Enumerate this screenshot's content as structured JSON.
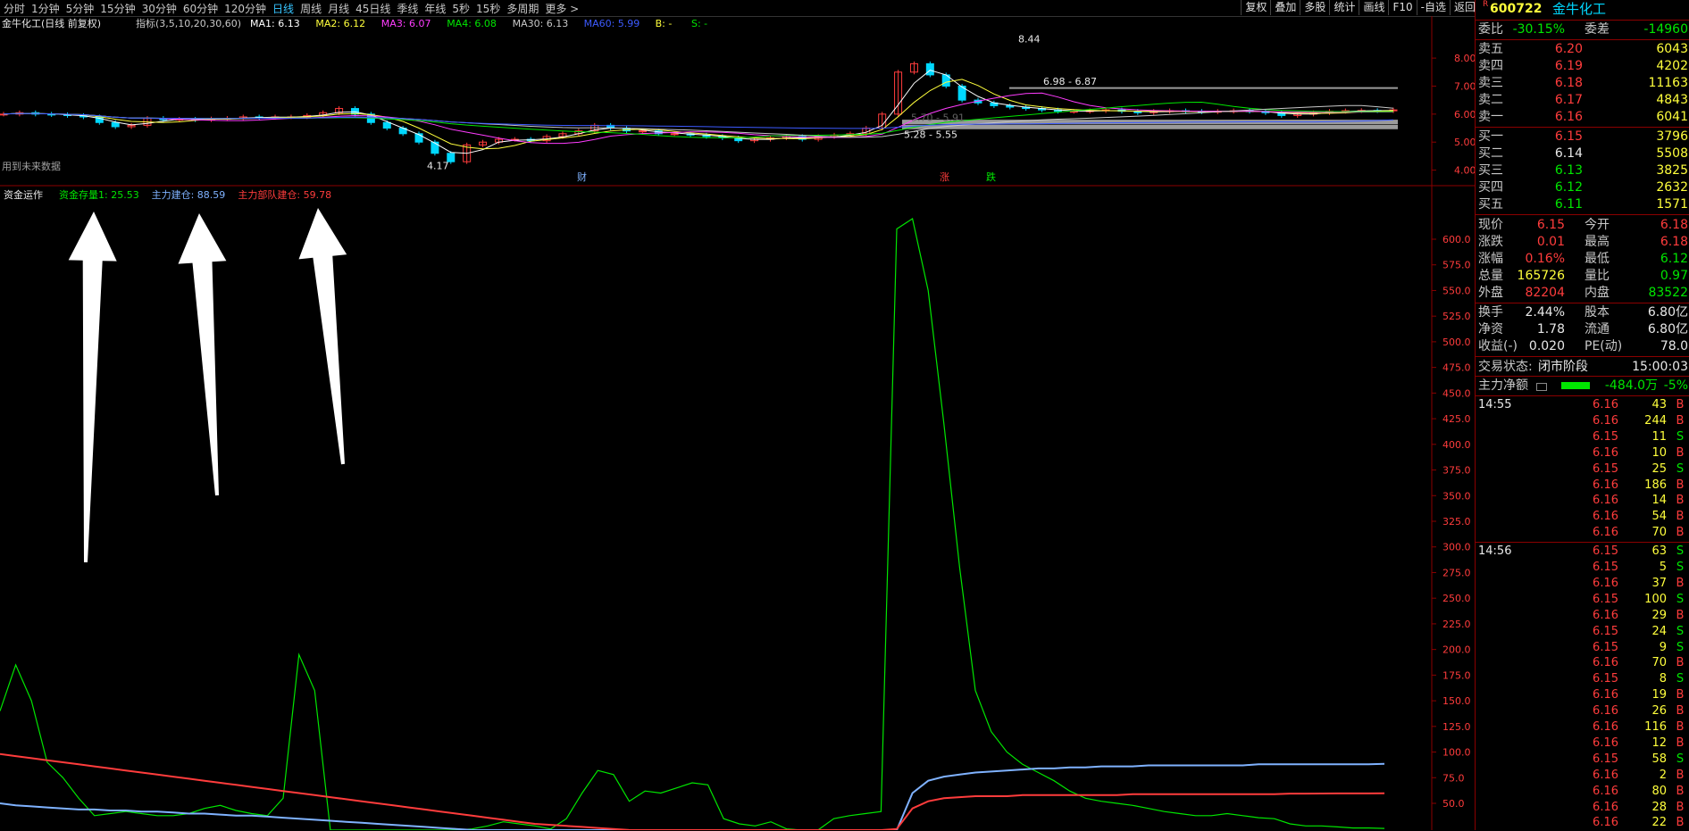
{
  "toolbar": {
    "periods": [
      "分时",
      "1分钟",
      "5分钟",
      "15分钟",
      "30分钟",
      "60分钟",
      "120分钟",
      "日线",
      "周线",
      "月线",
      "45日线",
      "季线",
      "年线",
      "5秒",
      "15秒",
      "多周期",
      "更多 >"
    ],
    "active_period": "日线",
    "right_buttons": [
      "复权",
      "叠加",
      "多股",
      "统计",
      "画线",
      "F10",
      "-自选",
      "返回"
    ]
  },
  "main_chart": {
    "title": "金牛化工(日线 前复权)",
    "indicator_name": "指标(3,5,10,20,30,60)",
    "ma_labels": [
      {
        "text": "MA1: 6.13",
        "color": "#ffffff"
      },
      {
        "text": "MA2: 6.12",
        "color": "#ffff3c"
      },
      {
        "text": "MA3: 6.07",
        "color": "#ff3cff"
      },
      {
        "text": "MA4: 6.08",
        "color": "#00e600"
      },
      {
        "text": "MA30: 6.13",
        "color": "#c8c8c8"
      },
      {
        "text": "MA60: 5.99",
        "color": "#3c5aff"
      },
      {
        "text": "B: -",
        "color": "#ffff3c"
      },
      {
        "text": "S: -",
        "color": "#00e600"
      }
    ],
    "y_ticks": [
      "8.00",
      "7.00",
      "6.00",
      "5.00",
      "4.00"
    ],
    "annotations": {
      "high": "8.44",
      "low": "4.17",
      "range1": "6.98 - 6.87",
      "range2": "5.28 - 5.55",
      "range3": "5.70 - 5.91",
      "future_note": "用到未来数据",
      "marker_cai": "财",
      "marker_zhang": "涨",
      "marker_die": "跌"
    }
  },
  "indicator_chart": {
    "name": "资金运作",
    "labels": [
      {
        "text": "资金存量1: 25.53",
        "color": "#00e600"
      },
      {
        "text": "主力建仓: 88.59",
        "color": "#7fb2ff"
      },
      {
        "text": "主力部队建仓: 59.78",
        "color": "#ff3c3c"
      }
    ],
    "y_ticks": [
      "600.0",
      "575.0",
      "550.0",
      "525.0",
      "500.0",
      "475.0",
      "450.0",
      "425.0",
      "400.0",
      "375.0",
      "350.0",
      "325.0",
      "300.0",
      "275.0",
      "250.0",
      "225.0",
      "200.0",
      "175.0",
      "150.0",
      "125.0",
      "100.0",
      "75.0",
      "50.0"
    ]
  },
  "chart_data": {
    "type": "line",
    "title": "资金运作",
    "xlabel": "",
    "ylabel": "",
    "ylim": [
      0,
      640
    ],
    "series": [
      {
        "name": "资金存量1",
        "color": "#00e600",
        "values": [
          140,
          185,
          150,
          90,
          75,
          55,
          38,
          40,
          42,
          40,
          38,
          38,
          40,
          45,
          48,
          43,
          40,
          38,
          55,
          195,
          160,
          12,
          8,
          6,
          5,
          8,
          12,
          15,
          18,
          22,
          25,
          28,
          32,
          30,
          28,
          25,
          35,
          60,
          82,
          78,
          52,
          62,
          60,
          65,
          70,
          68,
          35,
          30,
          28,
          32,
          25,
          22,
          24,
          35,
          38,
          40,
          42,
          610,
          620,
          550,
          420,
          280,
          160,
          120,
          100,
          88,
          80,
          72,
          62,
          55,
          52,
          50,
          48,
          45,
          42,
          40,
          38,
          38,
          40,
          38,
          36,
          35,
          30,
          28,
          28,
          27,
          26,
          26,
          25.53
        ]
      },
      {
        "name": "主力建仓",
        "color": "#7fb2ff",
        "values": [
          50,
          48,
          47,
          46,
          45,
          44,
          44,
          43,
          43,
          42,
          42,
          41,
          40,
          40,
          39,
          38,
          38,
          37,
          36,
          35,
          34,
          33,
          32,
          31,
          30,
          29,
          28,
          27,
          26,
          25,
          24,
          23,
          22,
          21,
          21,
          20,
          20,
          19,
          18,
          18,
          17,
          17,
          16,
          16,
          15,
          15,
          15,
          14,
          14,
          14,
          14,
          14,
          14,
          14,
          14,
          13,
          13,
          20,
          60,
          72,
          76,
          78,
          80,
          81,
          82,
          83,
          84,
          84,
          85,
          85,
          86,
          86,
          86,
          87,
          87,
          87,
          87,
          87,
          87,
          87,
          88,
          88,
          88,
          88,
          88,
          88,
          88,
          88,
          88.59
        ]
      },
      {
        "name": "主力部队建仓",
        "color": "#ff3c3c",
        "values": [
          98,
          96,
          94,
          92,
          90,
          88,
          86,
          84,
          82,
          80,
          78,
          76,
          74,
          72,
          70,
          68,
          66,
          64,
          62,
          60,
          58,
          56,
          54,
          52,
          50,
          48,
          46,
          44,
          42,
          40,
          38,
          36,
          34,
          32,
          30,
          29,
          28,
          27,
          26,
          25,
          24,
          23,
          22,
          21,
          20,
          20,
          19,
          19,
          18,
          18,
          18,
          17,
          17,
          17,
          17,
          17,
          17,
          25,
          45,
          52,
          55,
          56,
          57,
          57,
          57,
          58,
          58,
          58,
          58,
          58,
          58,
          58,
          59,
          59,
          59,
          59,
          59,
          59,
          59,
          59,
          59,
          59,
          59.5,
          59.5,
          59.6,
          59.7,
          59.7,
          59.7,
          59.78
        ]
      }
    ]
  },
  "panel": {
    "stock_flag": "R",
    "code": "600722",
    "name": "金牛化工",
    "weibi_label": "委比",
    "weibi": "-30.15%",
    "weicha_label": "委差",
    "weicha": "-14960",
    "asks": [
      {
        "label": "卖五",
        "price": "6.20",
        "vol": "6043"
      },
      {
        "label": "卖四",
        "price": "6.19",
        "vol": "4202"
      },
      {
        "label": "卖三",
        "price": "6.18",
        "vol": "11163"
      },
      {
        "label": "卖二",
        "price": "6.17",
        "vol": "4843"
      },
      {
        "label": "卖一",
        "price": "6.16",
        "vol": "6041"
      }
    ],
    "bids": [
      {
        "label": "买一",
        "price": "6.15",
        "vol": "3796",
        "pc": "red"
      },
      {
        "label": "买二",
        "price": "6.14",
        "vol": "5508",
        "pc": "white"
      },
      {
        "label": "买三",
        "price": "6.13",
        "vol": "3825",
        "pc": "green"
      },
      {
        "label": "买四",
        "price": "6.12",
        "vol": "2632",
        "pc": "green"
      },
      {
        "label": "买五",
        "price": "6.11",
        "vol": "1571",
        "pc": "green"
      }
    ],
    "stats": [
      {
        "l1": "现价",
        "v1": "6.15",
        "c1": "red",
        "l2": "今开",
        "v2": "6.18",
        "c2": "red"
      },
      {
        "l1": "涨跌",
        "v1": "0.01",
        "c1": "red",
        "l2": "最高",
        "v2": "6.18",
        "c2": "red"
      },
      {
        "l1": "涨幅",
        "v1": "0.16%",
        "c1": "red",
        "l2": "最低",
        "v2": "6.12",
        "c2": "green"
      },
      {
        "l1": "总量",
        "v1": "165726",
        "c1": "yellow",
        "l2": "量比",
        "v2": "0.97",
        "c2": "green"
      },
      {
        "l1": "外盘",
        "v1": "82204",
        "c1": "red",
        "l2": "内盘",
        "v2": "83522",
        "c2": "green"
      }
    ],
    "stats2": [
      {
        "l1": "换手",
        "v1": "2.44%",
        "c1": "white",
        "l2": "股本",
        "v2": "6.80亿",
        "c2": "white"
      },
      {
        "l1": "净资",
        "v1": "1.78",
        "c1": "white",
        "l2": "流通",
        "v2": "6.80亿",
        "c2": "white"
      },
      {
        "l1": "收益(-)",
        "v1": "0.020",
        "c1": "white",
        "l2": "PE(动)",
        "v2": "78.0",
        "c2": "white"
      }
    ],
    "trade_status_label": "交易状态:",
    "trade_status": "闭市阶段",
    "trade_time": "15:00:03",
    "main_net_label": "主力净额",
    "main_net": "-484.0万",
    "main_net_pct": "-5%",
    "ticks": [
      {
        "t": "14:55",
        "p": "6.16",
        "v": "43",
        "d": "B"
      },
      {
        "t": "",
        "p": "6.16",
        "v": "244",
        "d": "B"
      },
      {
        "t": "",
        "p": "6.15",
        "v": "11",
        "d": "S"
      },
      {
        "t": "",
        "p": "6.16",
        "v": "10",
        "d": "B"
      },
      {
        "t": "",
        "p": "6.15",
        "v": "25",
        "d": "S"
      },
      {
        "t": "",
        "p": "6.16",
        "v": "186",
        "d": "B"
      },
      {
        "t": "",
        "p": "6.16",
        "v": "14",
        "d": "B"
      },
      {
        "t": "",
        "p": "6.16",
        "v": "54",
        "d": "B"
      },
      {
        "t": "",
        "p": "6.16",
        "v": "70",
        "d": "B"
      },
      {
        "t": "14:56",
        "p": "6.15",
        "v": "63",
        "d": "S"
      },
      {
        "t": "",
        "p": "6.15",
        "v": "5",
        "d": "S"
      },
      {
        "t": "",
        "p": "6.16",
        "v": "37",
        "d": "B"
      },
      {
        "t": "",
        "p": "6.15",
        "v": "100",
        "d": "S"
      },
      {
        "t": "",
        "p": "6.16",
        "v": "29",
        "d": "B"
      },
      {
        "t": "",
        "p": "6.15",
        "v": "24",
        "d": "S"
      },
      {
        "t": "",
        "p": "6.15",
        "v": "9",
        "d": "S"
      },
      {
        "t": "",
        "p": "6.16",
        "v": "70",
        "d": "B"
      },
      {
        "t": "",
        "p": "6.15",
        "v": "8",
        "d": "S"
      },
      {
        "t": "",
        "p": "6.16",
        "v": "19",
        "d": "B"
      },
      {
        "t": "",
        "p": "6.16",
        "v": "26",
        "d": "B"
      },
      {
        "t": "",
        "p": "6.16",
        "v": "116",
        "d": "B"
      },
      {
        "t": "",
        "p": "6.16",
        "v": "12",
        "d": "B"
      },
      {
        "t": "",
        "p": "6.15",
        "v": "58",
        "d": "S"
      },
      {
        "t": "",
        "p": "6.16",
        "v": "2",
        "d": "B"
      },
      {
        "t": "",
        "p": "6.16",
        "v": "80",
        "d": "B"
      },
      {
        "t": "",
        "p": "6.16",
        "v": "28",
        "d": "B"
      },
      {
        "t": "",
        "p": "6.16",
        "v": "22",
        "d": "B"
      }
    ]
  }
}
